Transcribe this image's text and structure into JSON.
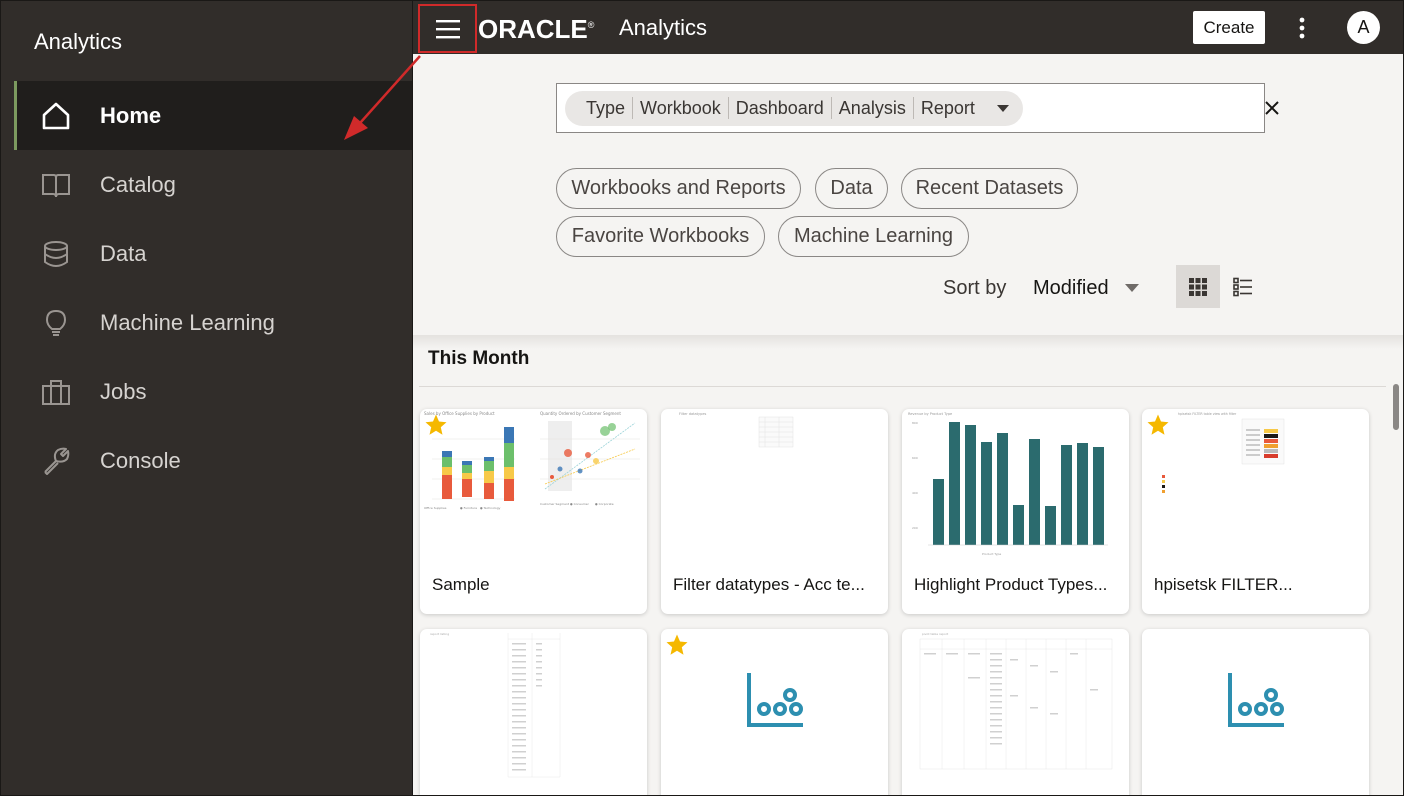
{
  "sidebar": {
    "title": "Analytics",
    "items": [
      {
        "label": "Home",
        "icon": "home-icon"
      },
      {
        "label": "Catalog",
        "icon": "book-icon"
      },
      {
        "label": "Data",
        "icon": "database-icon"
      },
      {
        "label": "Machine Learning",
        "icon": "lightbulb-icon"
      },
      {
        "label": "Jobs",
        "icon": "briefcase-icon"
      },
      {
        "label": "Console",
        "icon": "wrench-icon"
      }
    ]
  },
  "header": {
    "logo": "ORACLE",
    "product": "Analytics",
    "create_label": "Create",
    "avatar_initial": "A"
  },
  "search": {
    "type_filters": [
      "Type",
      "Workbook",
      "Dashboard",
      "Analysis",
      "Report"
    ],
    "value": ""
  },
  "filters": [
    "Workbooks and Reports",
    "Data",
    "Recent Datasets",
    "Favorite Workbooks",
    "Machine Learning"
  ],
  "sort": {
    "label": "Sort by",
    "value": "Modified"
  },
  "section": {
    "title": "This Month"
  },
  "cards": [
    {
      "title": "Sample",
      "favorite": true
    },
    {
      "title": "Filter datatypes - Acc te...",
      "favorite": false
    },
    {
      "title": "Highlight Product Types...",
      "favorite": false
    },
    {
      "title": "hpisetsk FILTER...",
      "favorite": true
    },
    {
      "title": "",
      "favorite": false
    },
    {
      "title": "",
      "favorite": true
    },
    {
      "title": "",
      "favorite": false
    },
    {
      "title": "",
      "favorite": false
    }
  ],
  "colors": {
    "topbar": "#312d2a",
    "active_accent": "#7c9a5f",
    "highlight_box": "#d02a2a",
    "chart_bar": "#2b6b6e",
    "star": "#f5b800",
    "ml_icon": "#2d8fb0"
  }
}
